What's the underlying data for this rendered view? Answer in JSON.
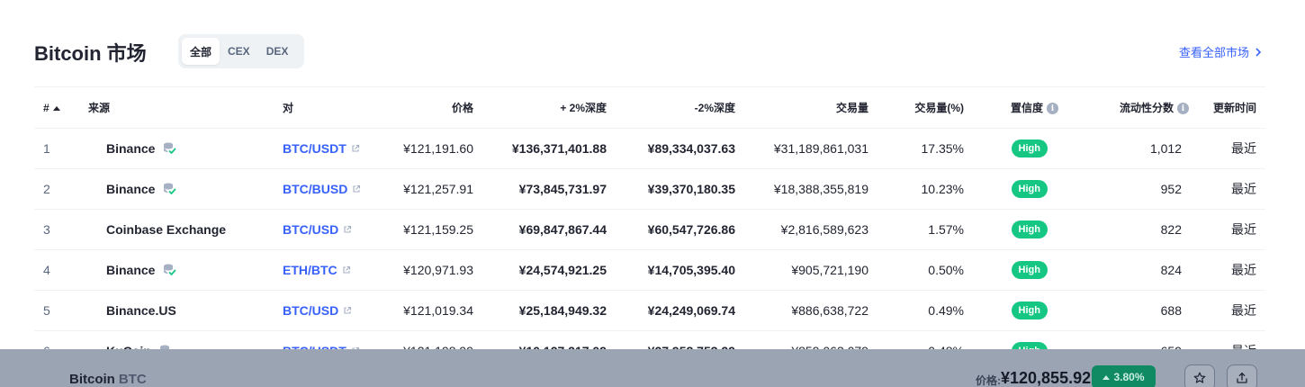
{
  "header": {
    "title": "Bitcoin 市场",
    "tabs": [
      {
        "label": "全部",
        "active": true
      },
      {
        "label": "CEX",
        "active": false
      },
      {
        "label": "DEX",
        "active": false
      }
    ],
    "view_all": "查看全部市场"
  },
  "table": {
    "columns": {
      "rank": "#",
      "source": "来源",
      "pair": "对",
      "price": "价格",
      "depth_plus": "+ 2%深度",
      "depth_minus": "-2%深度",
      "volume": "交易量",
      "volume_pct": "交易量(%)",
      "confidence": "置信度",
      "liquidity": "流动性分数",
      "updated": "更新时间"
    },
    "rows": [
      {
        "rank": "1",
        "source": "Binance",
        "verified": true,
        "pair": "BTC/USDT",
        "price": "¥121,191.60",
        "depth_plus": "¥136,371,401.88",
        "depth_minus": "¥89,334,037.63",
        "volume": "¥31,189,861,031",
        "volume_pct": "17.35%",
        "confidence": "High",
        "liquidity": "1,012",
        "updated": "最近"
      },
      {
        "rank": "2",
        "source": "Binance",
        "verified": true,
        "pair": "BTC/BUSD",
        "price": "¥121,257.91",
        "depth_plus": "¥73,845,731.97",
        "depth_minus": "¥39,370,180.35",
        "volume": "¥18,388,355,819",
        "volume_pct": "10.23%",
        "confidence": "High",
        "liquidity": "952",
        "updated": "最近"
      },
      {
        "rank": "3",
        "source": "Coinbase Exchange",
        "verified": false,
        "pair": "BTC/USD",
        "price": "¥121,159.25",
        "depth_plus": "¥69,847,867.44",
        "depth_minus": "¥60,547,726.86",
        "volume": "¥2,816,589,623",
        "volume_pct": "1.57%",
        "confidence": "High",
        "liquidity": "822",
        "updated": "最近"
      },
      {
        "rank": "4",
        "source": "Binance",
        "verified": true,
        "pair": "ETH/BTC",
        "price": "¥120,971.93",
        "depth_plus": "¥24,574,921.25",
        "depth_minus": "¥14,705,395.40",
        "volume": "¥905,721,190",
        "volume_pct": "0.50%",
        "confidence": "High",
        "liquidity": "824",
        "updated": "最近"
      },
      {
        "rank": "5",
        "source": "Binance.US",
        "verified": false,
        "pair": "BTC/USD",
        "price": "¥121,019.34",
        "depth_plus": "¥25,184,949.32",
        "depth_minus": "¥24,249,069.74",
        "volume": "¥886,638,722",
        "volume_pct": "0.49%",
        "confidence": "High",
        "liquidity": "688",
        "updated": "最近"
      },
      {
        "rank": "6",
        "source": "KuCoin",
        "verified": true,
        "pair": "BTC/USDT",
        "price": "¥121,198.99",
        "depth_plus": "¥10,127,217.09",
        "depth_minus": "¥27,958,753.29",
        "volume": "¥859,063,079",
        "volume_pct": "0.48%",
        "confidence": "High",
        "liquidity": "659",
        "updated": "最近"
      }
    ]
  },
  "sticky": {
    "name": "Bitcoin",
    "symbol": "BTC",
    "price_label": "价格:",
    "price": "¥120,855.92",
    "change": "3.80%"
  },
  "colors": {
    "link": "#3861fb",
    "high_badge": "#16c784",
    "sticky_bg": "#9ba4b2"
  }
}
